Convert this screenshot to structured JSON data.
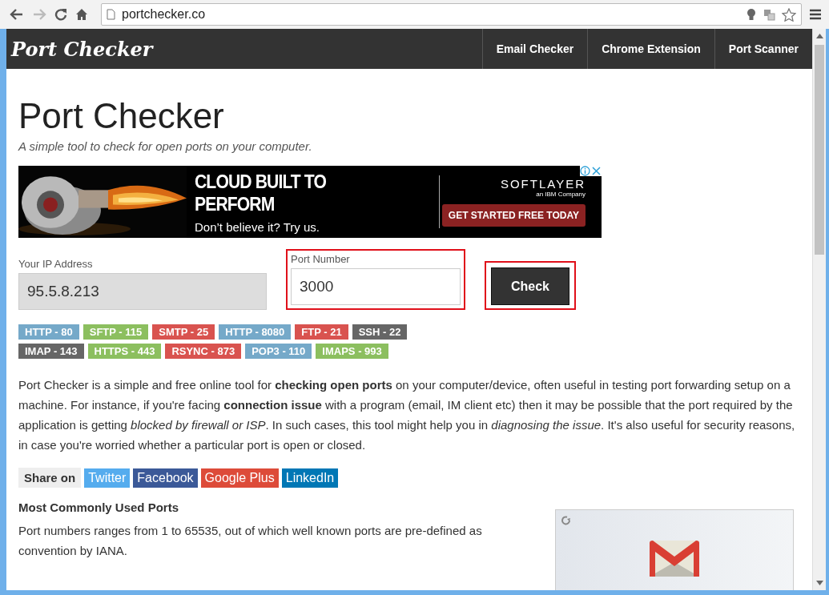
{
  "browser": {
    "url": "portchecker.co"
  },
  "header": {
    "logo": "Port Checker",
    "nav": [
      "Email Checker",
      "Chrome Extension",
      "Port Scanner"
    ]
  },
  "title": "Port Checker",
  "subtitle": "A simple tool to check for open ports on your computer.",
  "ad": {
    "headline": "CLOUD BUILT TO PERFORM",
    "subline": "Don’t believe it? Try us.",
    "brand": "SOFTLAYER",
    "brand_sub": "an IBM Company",
    "cta": "GET STARTED FREE TODAY"
  },
  "form": {
    "ip_label": "Your IP Address",
    "ip_value": "95.5.8.213",
    "port_label": "Port Number",
    "port_value": "3000",
    "button": "Check"
  },
  "ports": [
    {
      "label": "HTTP - 80",
      "color": "#75a9c9"
    },
    {
      "label": "SFTP - 115",
      "color": "#8cbf5f"
    },
    {
      "label": "SMTP - 25",
      "color": "#d9534f"
    },
    {
      "label": "HTTP - 8080",
      "color": "#75a9c9"
    },
    {
      "label": "FTP - 21",
      "color": "#d9534f"
    },
    {
      "label": "SSH - 22",
      "color": "#666666"
    },
    {
      "label": "IMAP - 143",
      "color": "#666666"
    },
    {
      "label": "HTTPS - 443",
      "color": "#8cbf5f"
    },
    {
      "label": "RSYNC - 873",
      "color": "#d9534f"
    },
    {
      "label": "POP3 - 110",
      "color": "#75a9c9"
    },
    {
      "label": "IMAPS - 993",
      "color": "#8cbf5f"
    }
  ],
  "intro": "Port Checker is a simple and free online tool for **checking open ports** on your computer/device, often useful in testing port forwarding setup on a machine. For instance, if you're facing **connection issue** with a program (email, IM client etc) then it may be possible that the port required by the application is getting *blocked by firewall or ISP*. In such cases, this tool might help you in *diagnosing the issue*. It's also useful for security reasons, in case you're worried whether a particular port is open or closed.",
  "share": {
    "label": "Share on",
    "buttons": [
      {
        "label": "Twitter",
        "color": "#55acee"
      },
      {
        "label": "Facebook",
        "color": "#3b5998"
      },
      {
        "label": "Google Plus",
        "color": "#dd4b39"
      },
      {
        "label": "LinkedIn",
        "color": "#0077b5"
      }
    ]
  },
  "common": {
    "heading": "Most Commonly Used Ports",
    "text": "Port numbers ranges from 1 to 65535, out of which well known ports are pre-defined as convention by IANA."
  }
}
